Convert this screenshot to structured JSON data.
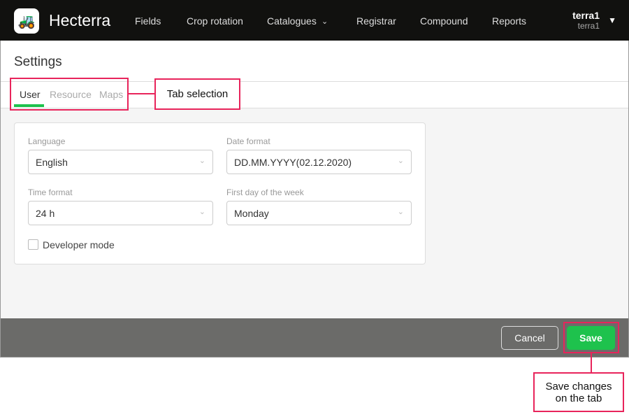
{
  "nav": {
    "brand": "Hecterra",
    "items": [
      "Fields",
      "Crop rotation",
      "Catalogues",
      "Registrar",
      "Compound",
      "Reports"
    ],
    "user_name": "terra1",
    "user_sub": "terra1"
  },
  "page": {
    "title": "Settings",
    "tabs": [
      "User",
      "Resource",
      "Maps"
    ]
  },
  "form": {
    "language_label": "Language",
    "language": "English",
    "date_label": "Date format",
    "date": "DD.MM.YYYY(02.12.2020)",
    "time_label": "Time format",
    "time": "24 h",
    "week_label": "First day of the week",
    "week": "Monday",
    "dev_label": "Developer mode"
  },
  "footer": {
    "cancel": "Cancel",
    "save": "Save"
  },
  "annotations": {
    "tabs": "Tab selection",
    "save": "Save changes on the tab"
  }
}
